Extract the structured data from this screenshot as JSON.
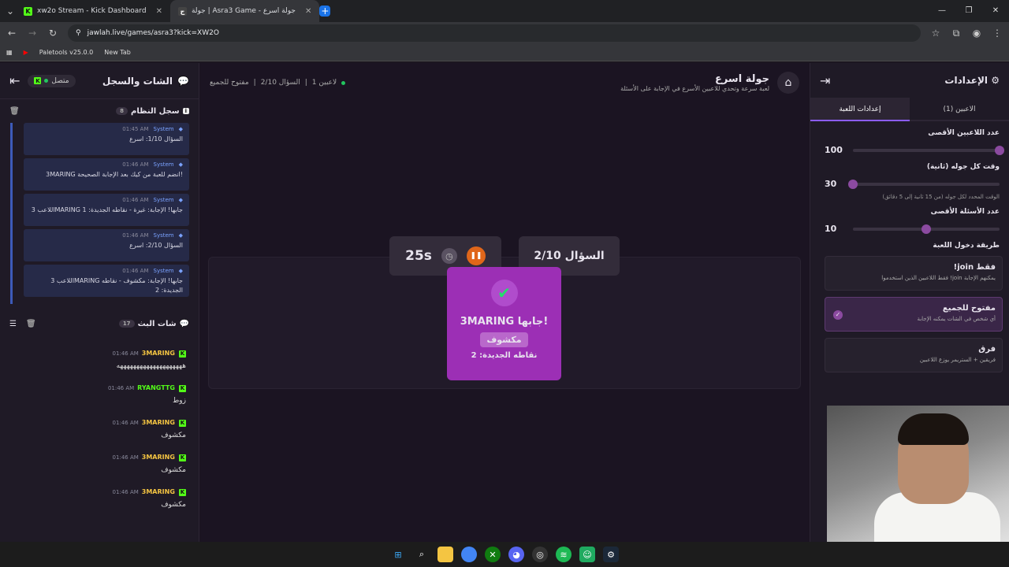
{
  "browser": {
    "tabs": [
      {
        "title": "xw2o Stream - Kick Dashboard"
      },
      {
        "title": "جولة | Asra3 Game - جولة اسرع"
      }
    ],
    "url": "jawlah.live/games/asra3?kick=XW2O",
    "bookmarks": [
      "Paletools v25.0.0",
      "New Tab"
    ]
  },
  "left": {
    "title": "الشات والسجل",
    "status": "متصل",
    "system_log": {
      "title": "سجل النظام",
      "count": "8",
      "messages": [
        {
          "time": "01:45 AM",
          "sender": "System",
          "text": "السؤال 1/10: اسرع"
        },
        {
          "time": "01:46 AM",
          "sender": "System",
          "text": "3MARING انضم للعبة من كيك بعد الإجابة الصحيحة!"
        },
        {
          "time": "01:46 AM",
          "sender": "System",
          "text": "اللاعب 3MARING جابها! الإجابة: غيرة - نقاطه الجديدة: 1"
        },
        {
          "time": "01:46 AM",
          "sender": "System",
          "text": "السؤال 2/10: اسرع"
        },
        {
          "time": "01:46 AM",
          "sender": "System",
          "text": "اللاعب 3MARING جابها! الإجابة: مكشوف - نقاطه الجديدة: 2"
        }
      ]
    },
    "stream_chat": {
      "title": "شات البث",
      "count": "17",
      "messages": [
        {
          "time": "01:46 AM",
          "user": "3MARING",
          "color": "#f5c542",
          "text": "ههههههههههههههههههههه"
        },
        {
          "time": "01:46 AM",
          "user": "RYANGTTG",
          "color": "#53fc18",
          "text": "زوط"
        },
        {
          "time": "01:46 AM",
          "user": "3MARING",
          "color": "#f5c542",
          "text": "مكشوف"
        },
        {
          "time": "01:46 AM",
          "user": "3MARING",
          "color": "#f5c542",
          "text": "مكشوف"
        },
        {
          "time": "01:46 AM",
          "user": "3MARING",
          "color": "#f5c542",
          "text": "مكشوف"
        }
      ]
    }
  },
  "center": {
    "title": "جولة اسرع",
    "subtitle": "لعبة سرعة وتحدي للاعبين الأسرع في الإجابة على الأسئلة",
    "players": "1 لاعبين",
    "question": "السؤال 2/10",
    "mode": "مفتوح للجميع",
    "timer": "25s",
    "question_box": "السؤال 2/10",
    "winner": {
      "name": "3MARING جابها!",
      "answer": "مكشوف",
      "points": "نقاطه الجديدة: 2"
    }
  },
  "right": {
    "title": "الإعدادات",
    "tabs": [
      "الاعبين (1)",
      "إعدادات اللعبة"
    ],
    "max_players": {
      "label": "عدد اللاعبين الأقصى",
      "value": "100",
      "fraction": 0
    },
    "round_time": {
      "label": "وقت كل جوله (ثانية)",
      "value": "30",
      "fraction": 1,
      "hint": "الوقت المحدد لكل جوله (من 15 ثانية إلى 5 دقائق)"
    },
    "max_questions": {
      "label": "عدد الأسئلة الأقصى",
      "value": "10",
      "fraction": 0.5
    },
    "join_mode": {
      "label": "طريقة دخول اللعبة",
      "options": [
        {
          "title": "!join فقط",
          "desc": "فقط اللاعبين الذين استخدموا !join يمكنهم الإجابة"
        },
        {
          "title": "مفتوح للجميع",
          "desc": "أي شخص في الشات يمكنه الإجابة"
        },
        {
          "title": "فرق",
          "desc": "فريقين + الستريمر يوزع اللاعبين"
        }
      ]
    }
  }
}
